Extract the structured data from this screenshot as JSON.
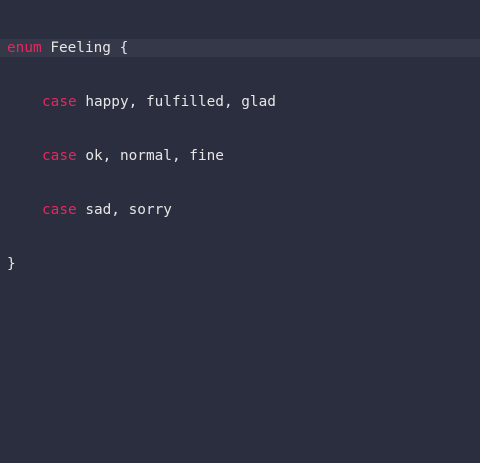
{
  "colors": {
    "background": "#2a2e3e",
    "current_line": "#343849",
    "keyword": "#e8265e",
    "text": "#e6e6e6"
  },
  "code": {
    "line1": {
      "keyword": "enum",
      "rest": " Feeling {"
    },
    "line2": {
      "keyword": "case",
      "rest": " happy, fulfilled, glad"
    },
    "line3": {
      "keyword": "case",
      "rest": " ok, normal, fine"
    },
    "line4": {
      "keyword": "case",
      "rest": " sad, sorry"
    },
    "line5": {
      "rest": "}"
    }
  }
}
